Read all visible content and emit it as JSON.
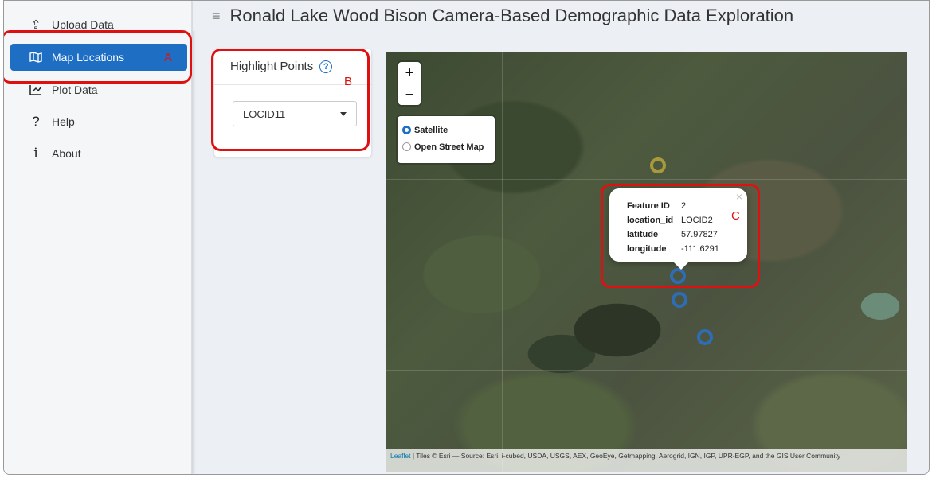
{
  "sidebar": {
    "items": [
      {
        "label": "Upload Data",
        "icon": "upload-icon"
      },
      {
        "label": "Map Locations",
        "icon": "map-icon",
        "active": true
      },
      {
        "label": "Plot Data",
        "icon": "chart-icon"
      },
      {
        "label": "Help",
        "icon": "question-icon"
      },
      {
        "label": "About",
        "icon": "info-icon"
      }
    ]
  },
  "header": {
    "title": "Ronald Lake Wood Bison Camera-Based Demographic Data Exploration"
  },
  "highlight_card": {
    "title": "Highlight Points",
    "help_icon": "?",
    "collapse_icon": "–",
    "select_value": "LOCID11"
  },
  "map": {
    "zoom_in": "+",
    "zoom_out": "−",
    "layers": [
      {
        "label": "Satellite",
        "selected": true
      },
      {
        "label": "Open Street Map",
        "selected": false
      }
    ],
    "popup": {
      "close": "×",
      "rows": [
        {
          "key": "Feature ID",
          "value": "2"
        },
        {
          "key": "location_id",
          "value": "LOCID2"
        },
        {
          "key": "latitude",
          "value": "57.97827"
        },
        {
          "key": "longitude",
          "value": "-111.6291"
        }
      ]
    },
    "attribution_link": "Leaflet",
    "attribution_text": " | Tiles © Esri — Source: Esri, i-cubed, USDA, USGS, AEX, GeoEye, Getmapping, Aerogrid, IGN, IGP, UPR-EGP, and the GIS User Community"
  },
  "annotations": {
    "a": "A",
    "b": "B",
    "c": "C"
  },
  "colors": {
    "accent": "#1e6ec4",
    "annotation": "#e01010",
    "marker_blue": "#2e6db4",
    "marker_yellow": "#a89a3a"
  }
}
